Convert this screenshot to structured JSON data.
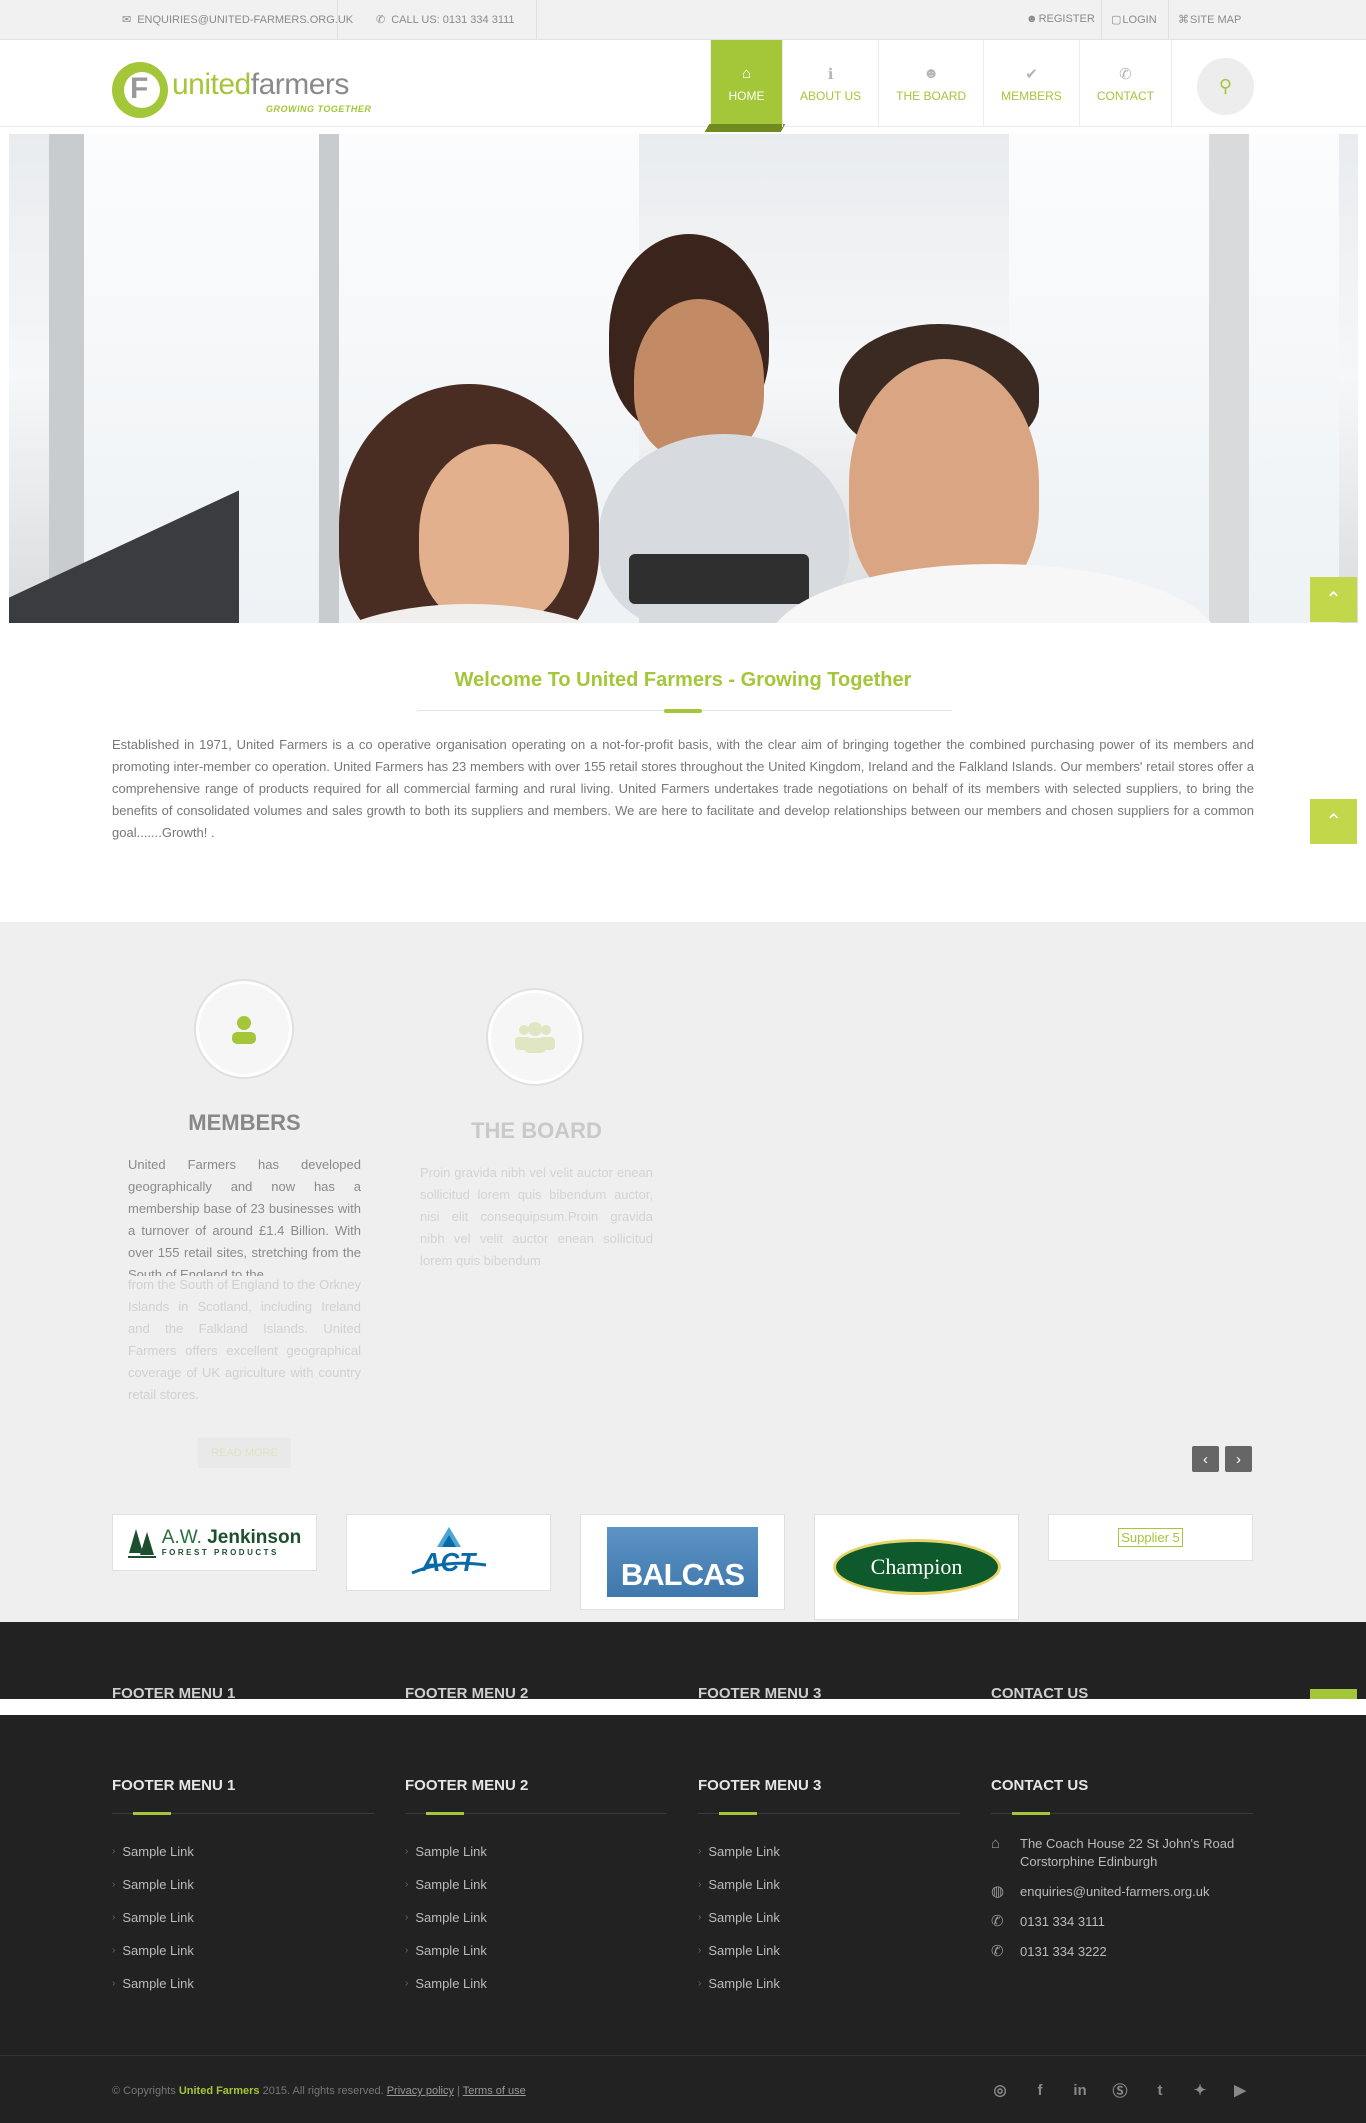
{
  "topbar": {
    "email": "ENQUIRIES@UNITED-FARMERS.ORG.UK",
    "phone": "CALL US: 0131 334 3111",
    "register": "REGISTER",
    "login": "LOGIN",
    "sitemap": "SITE MAP"
  },
  "logo": {
    "word_a": "united",
    "word_b": "farmers",
    "tagline": "GROWING TOGETHER"
  },
  "nav": [
    {
      "label": "HOME",
      "icon": "home-icon",
      "active": true
    },
    {
      "label": "ABOUT US",
      "icon": "info-icon"
    },
    {
      "label": "THE BOARD",
      "icon": "users-icon"
    },
    {
      "label": "MEMBERS",
      "icon": "check-circle-icon"
    },
    {
      "label": "CONTACT",
      "icon": "phone-icon"
    }
  ],
  "welcome": {
    "title": "Welcome To United Farmers - Growing Together",
    "text": "Established in 1971, United Farmers is a co operative organisation operating on a not-for-profit basis, with the clear aim of bringing together the combined purchasing power of its members and promoting inter-member co operation. United Farmers has 23 members with over 155 retail stores throughout the United Kingdom, Ireland and the Falkland Islands. Our members' retail stores offer a comprehensive range of products required for all commercial farming and rural living. United Farmers undertakes trade negotiations on behalf of its members with selected suppliers, to bring the benefits of consolidated volumes and sales growth to both its suppliers and members. We are here to facilitate and develop relationships between our members and chosen suppliers for a common goal.......Growth! ."
  },
  "services": {
    "members": {
      "title": "MEMBERS",
      "text_visible": "United Farmers has developed geographically and now has a membership base of 23 businesses with a turnover of around £1.4 Billion. With over 155 retail sites, stretching from the South of England to the",
      "text_faded": "from the South of England to the Orkney Islands in Scotland, including Ireland and the Falkland Islands. United Farmers offers excellent geographical coverage of UK agriculture with country retail stores.",
      "button": "READ MORE"
    },
    "board": {
      "title": "THE BOARD",
      "text": "Proin gravida nibh vel velit auctor enean sollicitud lorem quis bibendum auctor, nisi elit consequipsum.Proin gravida nibh vel velit auctor enean sollicitud lorem quis bibendum"
    },
    "prev": "‹",
    "next": "›"
  },
  "suppliers": {
    "jenkinson_a": "A.W.",
    "jenkinson_b": "Jenkinson",
    "jenkinson_sub": "FOREST PRODUCTS",
    "act": "ACT",
    "balcas": "BALCAS",
    "champion": "Champion",
    "supplier5": "Supplier 5"
  },
  "footer": {
    "col1": {
      "title": "FOOTER MENU 1",
      "links": [
        "Sample Link",
        "Sample Link",
        "Sample Link",
        "Sample Link",
        "Sample Link"
      ]
    },
    "col2": {
      "title": "FOOTER MENU 2",
      "links": [
        "Sample Link",
        "Sample Link",
        "Sample Link",
        "Sample Link",
        "Sample Link"
      ]
    },
    "col3": {
      "title": "FOOTER MENU 3",
      "links": [
        "Sample Link",
        "Sample Link",
        "Sample Link",
        "Sample Link",
        "Sample Link"
      ]
    },
    "contact": {
      "title": "CONTACT US",
      "address": "The Coach House 22 St John's Road Corstorphine Edinburgh",
      "email": "enquiries@united-farmers.org.uk",
      "phone1": "0131 334 3111",
      "phone2": "0131 334 3222"
    }
  },
  "copyright": {
    "prefix": "© Copyrights",
    "brand": "United Farmers",
    "suffix": "2015. All rights reserved.",
    "privacy": "Privacy policy",
    "divider": "|",
    "terms": "Terms of use"
  },
  "social": [
    "dribbble-icon",
    "facebook-icon",
    "linkedin-icon",
    "skype-icon",
    "tumblr-icon",
    "twitter-icon",
    "youtube-icon"
  ],
  "colors": {
    "accent": "#a4c639",
    "footer": "#222222",
    "band": "#efefef"
  }
}
